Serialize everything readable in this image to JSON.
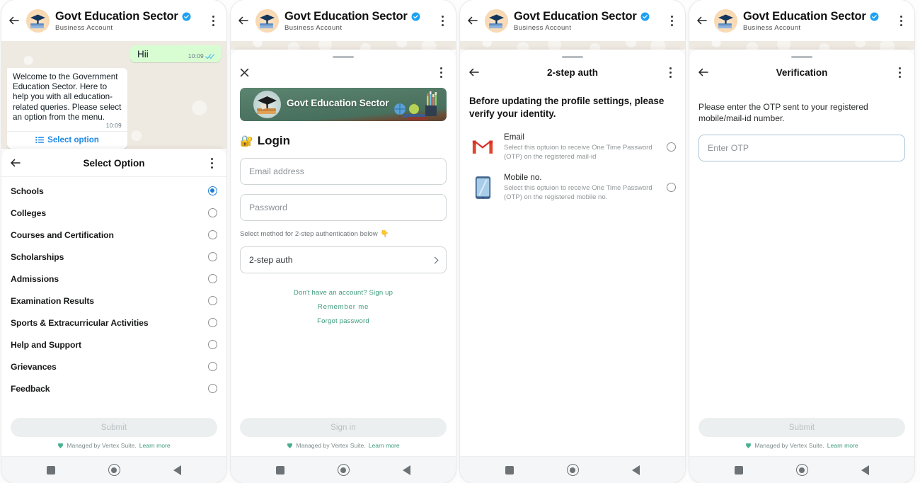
{
  "header": {
    "title": "Govt Education Sector",
    "subtitle": "Business Account",
    "verified_icon": "verified-badge-icon",
    "back_icon": "back-arrow-icon",
    "menu_icon": "kebab-menu-icon",
    "avatar_icon": "graduation-cap-books-avatar"
  },
  "colors": {
    "accent_blue": "#1e88e5",
    "verified_blue": "#1da1f2",
    "brand_green": "#3f9b7d",
    "banner_green": "#4e7663",
    "chat_wallpaper": "#efeae2",
    "outgoing_bubble": "#d9fdd3",
    "gmail_red": "#d93025",
    "phone_blue": "#4a7fb5",
    "radio_selected": "#1e7fd4"
  },
  "footer": {
    "managed_text": "Managed by Vertex Suite.",
    "learn_more": "Learn more",
    "shield_icon": "shield-icon"
  },
  "android_nav": {
    "recents_icon": "square-recents-icon",
    "home_icon": "circle-home-icon",
    "back_icon": "triangle-back-icon"
  },
  "panel1": {
    "chat": {
      "outgoing": {
        "text": "Hii",
        "time": "10:09",
        "ticks_icon": "double-check-read-icon"
      },
      "incoming": {
        "text": "Welcome to the Government Education Sector. Here to help you with all education-related queries. Please select an option from the menu.",
        "time": "10:09",
        "action_label": "Select option",
        "action_icon": "list-menu-icon"
      }
    },
    "sheet": {
      "title": "Select Option",
      "options": [
        {
          "label": "Schools",
          "selected": true
        },
        {
          "label": "Colleges",
          "selected": false
        },
        {
          "label": "Courses and Certification",
          "selected": false
        },
        {
          "label": "Scholarships",
          "selected": false
        },
        {
          "label": "Admissions",
          "selected": false
        },
        {
          "label": "Examination Results",
          "selected": false
        },
        {
          "label": "Sports & Extracurricular Activities",
          "selected": false
        },
        {
          "label": "Help and Support",
          "selected": false
        },
        {
          "label": "Grievances",
          "selected": false
        },
        {
          "label": "Feedback",
          "selected": false
        }
      ],
      "submit_label": "Submit"
    }
  },
  "panel2": {
    "sheet": {
      "close_icon": "close-x-icon",
      "menu_icon": "kebab-menu-icon",
      "banner_title": "Govt Education Sector",
      "banner_icon": "chalkboard-school-supplies-banner",
      "login_heading": "Login",
      "login_emoji": "🔐",
      "fields": [
        {
          "name": "email",
          "placeholder": "Email address",
          "value": ""
        },
        {
          "name": "password",
          "placeholder": "Password",
          "value": ""
        }
      ],
      "hint": "Select method for 2-step authentication below",
      "hint_emoji": "👇",
      "select": {
        "label": "2-step auth",
        "chevron_icon": "chevron-right-icon"
      },
      "links": [
        "Don't have an account? Sign up",
        "Remember me",
        "Forgot password"
      ],
      "submit_label": "Sign in"
    }
  },
  "panel3": {
    "sheet": {
      "title": "2-step auth",
      "back_icon": "back-arrow-icon",
      "menu_icon": "kebab-menu-icon",
      "heading": "Before updating the profile settings, please verify your identity.",
      "methods": [
        {
          "icon": "gmail-icon",
          "title": "Email",
          "description": "Select this optuion to receive One Time Password (OTP) on the registered mail-id",
          "selected": false
        },
        {
          "icon": "mobile-phone-icon",
          "title": "Mobile no.",
          "description": "Select this optuion to receive One Time Password (OTP) on the registered mobile no.",
          "selected": false
        }
      ]
    }
  },
  "panel4": {
    "sheet": {
      "title": "Verification",
      "back_icon": "back-arrow-icon",
      "menu_icon": "kebab-menu-icon",
      "instruction": "Please enter the OTP sent to your registered mobile/mail-id number.",
      "otp_field": {
        "placeholder": "Enter OTP",
        "value": ""
      },
      "submit_label": "Submit"
    }
  }
}
